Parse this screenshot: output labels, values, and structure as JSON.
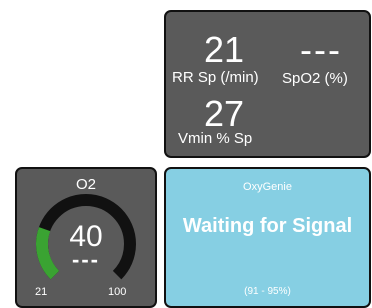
{
  "ventilation": {
    "rr_value": "21",
    "rr_label": "RR Sp (/min)",
    "spo2_value": "---",
    "spo2_label": "SpO2 (%)",
    "vmin_value": "27",
    "vmin_label": "Vmin % Sp"
  },
  "o2": {
    "title": "O2",
    "value": "40",
    "setting": "---",
    "min": "21",
    "max": "100",
    "level_fraction": 0.24
  },
  "oxygenie": {
    "title": "OxyGenie",
    "status": "Waiting for Signal",
    "range": "(91 - 95%)"
  },
  "colors": {
    "panel": "#5a5a5a",
    "oxygenie_bg": "#86cfe3",
    "gauge_green": "#3aa332",
    "gauge_track": "#111111"
  }
}
